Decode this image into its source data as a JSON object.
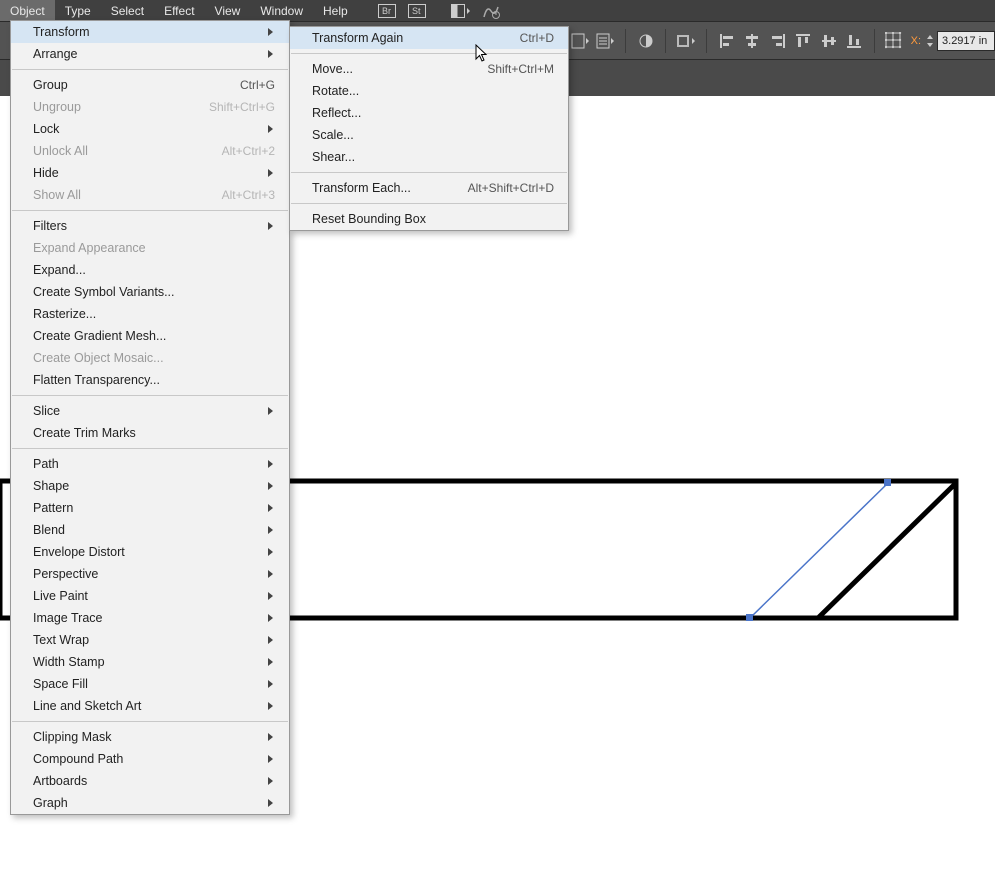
{
  "menubar": {
    "items": [
      "Object",
      "Type",
      "Select",
      "Effect",
      "View",
      "Window",
      "Help"
    ],
    "active_index": 0
  },
  "controlbar": {
    "x_label": "X:",
    "x_value": "3.2917 in"
  },
  "object_menu": {
    "groups": [
      [
        {
          "label": "Transform",
          "shortcut": "",
          "arrow": true,
          "disabled": false,
          "highlight": true,
          "name": "menu-transform"
        },
        {
          "label": "Arrange",
          "shortcut": "",
          "arrow": true,
          "disabled": false,
          "name": "menu-arrange"
        }
      ],
      [
        {
          "label": "Group",
          "shortcut": "Ctrl+G",
          "arrow": false,
          "disabled": false,
          "name": "menu-group"
        },
        {
          "label": "Ungroup",
          "shortcut": "Shift+Ctrl+G",
          "arrow": false,
          "disabled": true,
          "name": "menu-ungroup"
        },
        {
          "label": "Lock",
          "shortcut": "",
          "arrow": true,
          "disabled": false,
          "name": "menu-lock"
        },
        {
          "label": "Unlock All",
          "shortcut": "Alt+Ctrl+2",
          "arrow": false,
          "disabled": true,
          "name": "menu-unlock-all"
        },
        {
          "label": "Hide",
          "shortcut": "",
          "arrow": true,
          "disabled": false,
          "name": "menu-hide"
        },
        {
          "label": "Show All",
          "shortcut": "Alt+Ctrl+3",
          "arrow": false,
          "disabled": true,
          "name": "menu-show-all"
        }
      ],
      [
        {
          "label": "Filters",
          "shortcut": "",
          "arrow": true,
          "disabled": false,
          "name": "menu-filters"
        },
        {
          "label": "Expand Appearance",
          "shortcut": "",
          "arrow": false,
          "disabled": true,
          "name": "menu-expand-appearance"
        },
        {
          "label": "Expand...",
          "shortcut": "",
          "arrow": false,
          "disabled": false,
          "name": "menu-expand"
        },
        {
          "label": "Create Symbol Variants...",
          "shortcut": "",
          "arrow": false,
          "disabled": false,
          "name": "menu-create-symbol-variants"
        },
        {
          "label": "Rasterize...",
          "shortcut": "",
          "arrow": false,
          "disabled": false,
          "name": "menu-rasterize"
        },
        {
          "label": "Create Gradient Mesh...",
          "shortcut": "",
          "arrow": false,
          "disabled": false,
          "name": "menu-create-gradient-mesh"
        },
        {
          "label": "Create Object Mosaic...",
          "shortcut": "",
          "arrow": false,
          "disabled": true,
          "name": "menu-create-object-mosaic"
        },
        {
          "label": "Flatten Transparency...",
          "shortcut": "",
          "arrow": false,
          "disabled": false,
          "name": "menu-flatten-transparency"
        }
      ],
      [
        {
          "label": "Slice",
          "shortcut": "",
          "arrow": true,
          "disabled": false,
          "name": "menu-slice"
        },
        {
          "label": "Create Trim Marks",
          "shortcut": "",
          "arrow": false,
          "disabled": false,
          "name": "menu-create-trim-marks"
        }
      ],
      [
        {
          "label": "Path",
          "shortcut": "",
          "arrow": true,
          "disabled": false,
          "name": "menu-path"
        },
        {
          "label": "Shape",
          "shortcut": "",
          "arrow": true,
          "disabled": false,
          "name": "menu-shape"
        },
        {
          "label": "Pattern",
          "shortcut": "",
          "arrow": true,
          "disabled": false,
          "name": "menu-pattern"
        },
        {
          "label": "Blend",
          "shortcut": "",
          "arrow": true,
          "disabled": false,
          "name": "menu-blend"
        },
        {
          "label": "Envelope Distort",
          "shortcut": "",
          "arrow": true,
          "disabled": false,
          "name": "menu-envelope-distort"
        },
        {
          "label": "Perspective",
          "shortcut": "",
          "arrow": true,
          "disabled": false,
          "name": "menu-perspective"
        },
        {
          "label": "Live Paint",
          "shortcut": "",
          "arrow": true,
          "disabled": false,
          "name": "menu-live-paint"
        },
        {
          "label": "Image Trace",
          "shortcut": "",
          "arrow": true,
          "disabled": false,
          "name": "menu-image-trace"
        },
        {
          "label": "Text Wrap",
          "shortcut": "",
          "arrow": true,
          "disabled": false,
          "name": "menu-text-wrap"
        },
        {
          "label": "Width Stamp",
          "shortcut": "",
          "arrow": true,
          "disabled": false,
          "name": "menu-width-stamp"
        },
        {
          "label": "Space Fill",
          "shortcut": "",
          "arrow": true,
          "disabled": false,
          "name": "menu-space-fill"
        },
        {
          "label": "Line and Sketch Art",
          "shortcut": "",
          "arrow": true,
          "disabled": false,
          "name": "menu-line-and-sketch-art"
        }
      ],
      [
        {
          "label": "Clipping Mask",
          "shortcut": "",
          "arrow": true,
          "disabled": false,
          "name": "menu-clipping-mask"
        },
        {
          "label": "Compound Path",
          "shortcut": "",
          "arrow": true,
          "disabled": false,
          "name": "menu-compound-path"
        },
        {
          "label": "Artboards",
          "shortcut": "",
          "arrow": true,
          "disabled": false,
          "name": "menu-artboards"
        },
        {
          "label": "Graph",
          "shortcut": "",
          "arrow": true,
          "disabled": false,
          "name": "menu-graph"
        }
      ]
    ]
  },
  "transform_menu": {
    "groups": [
      [
        {
          "label": "Transform Again",
          "shortcut": "Ctrl+D",
          "arrow": false,
          "disabled": false,
          "highlight": true,
          "name": "menu-transform-again"
        }
      ],
      [
        {
          "label": "Move...",
          "shortcut": "Shift+Ctrl+M",
          "arrow": false,
          "disabled": false,
          "name": "menu-move"
        },
        {
          "label": "Rotate...",
          "shortcut": "",
          "arrow": false,
          "disabled": false,
          "name": "menu-rotate"
        },
        {
          "label": "Reflect...",
          "shortcut": "",
          "arrow": false,
          "disabled": false,
          "name": "menu-reflect"
        },
        {
          "label": "Scale...",
          "shortcut": "",
          "arrow": false,
          "disabled": false,
          "name": "menu-scale"
        },
        {
          "label": "Shear...",
          "shortcut": "",
          "arrow": false,
          "disabled": false,
          "name": "menu-shear"
        }
      ],
      [
        {
          "label": "Transform Each...",
          "shortcut": "Alt+Shift+Ctrl+D",
          "arrow": false,
          "disabled": false,
          "name": "menu-transform-each"
        }
      ],
      [
        {
          "label": "Reset Bounding Box",
          "shortcut": "",
          "arrow": false,
          "disabled": false,
          "name": "menu-reset-bounding-box"
        }
      ]
    ]
  }
}
